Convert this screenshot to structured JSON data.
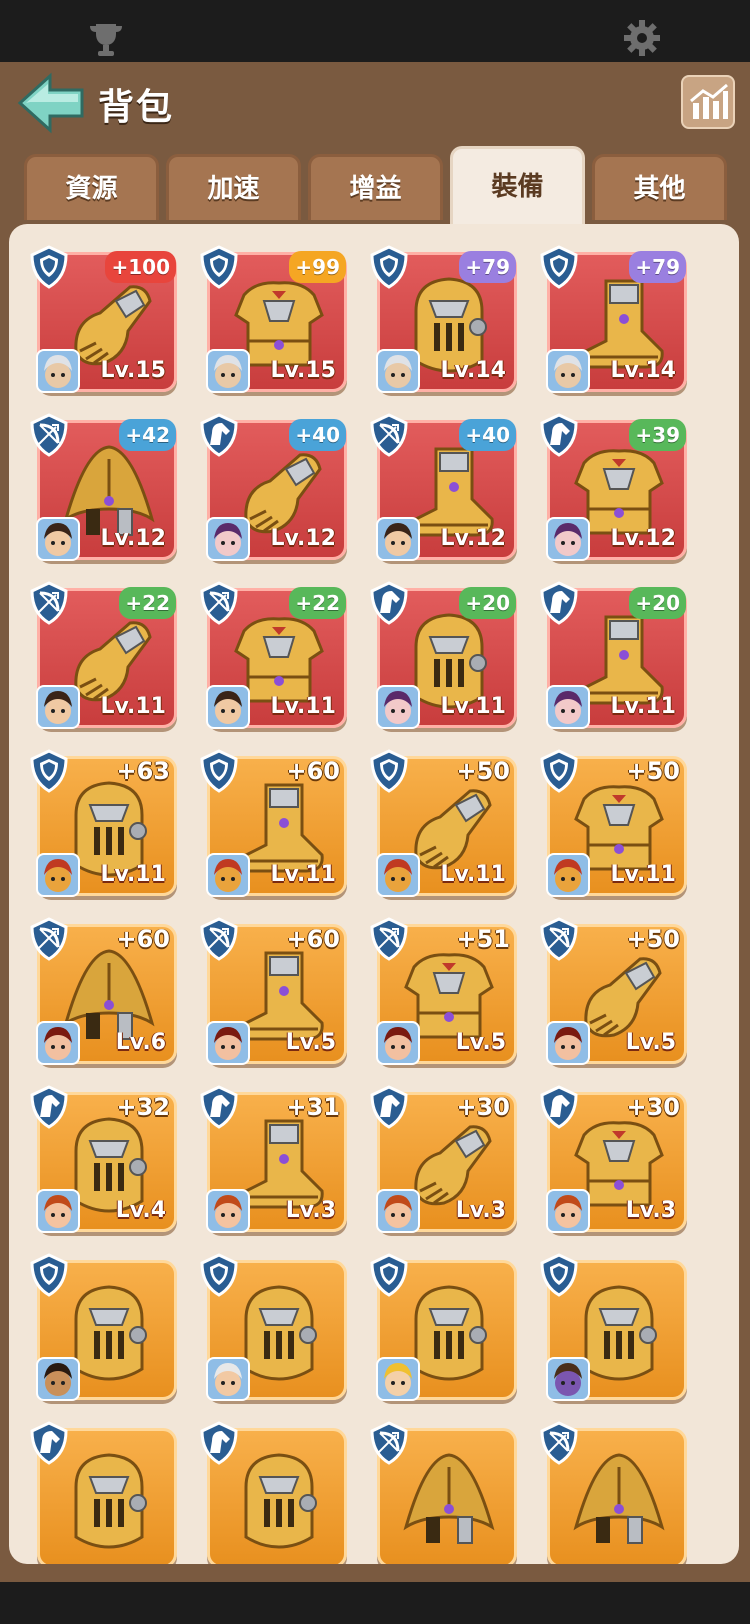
{
  "app": {
    "title": "背包"
  },
  "tabs": [
    {
      "label": "資源",
      "active": false
    },
    {
      "label": "加速",
      "active": false
    },
    {
      "label": "增益",
      "active": false
    },
    {
      "label": "裝備",
      "active": true
    },
    {
      "label": "其他",
      "active": false
    }
  ],
  "colors": {
    "red_card": "#d84b4b",
    "gold_card": "#f0a23a",
    "panel": "#7a5a40",
    "grid_bg": "#f2e6d8"
  },
  "items": [
    {
      "troop": "shield-icon",
      "bonus": "+100",
      "badge_color": "#e8453c",
      "hero": "white-hair",
      "level": "Lv.15",
      "tier": "red",
      "gear": "gauntlet"
    },
    {
      "troop": "shield-icon",
      "bonus": "+99",
      "badge_color": "#f5a623",
      "hero": "white-hair",
      "level": "Lv.15",
      "tier": "red",
      "gear": "chest"
    },
    {
      "troop": "shield-icon",
      "bonus": "+79",
      "badge_color": "#9a7fe0",
      "hero": "white-hair",
      "level": "Lv.14",
      "tier": "red",
      "gear": "helmet"
    },
    {
      "troop": "shield-icon",
      "bonus": "+79",
      "badge_color": "#9a7fe0",
      "hero": "white-hair",
      "level": "Lv.14",
      "tier": "red",
      "gear": "boot"
    },
    {
      "troop": "bow-icon",
      "bonus": "+42",
      "badge_color": "#4aa3d8",
      "hero": "dark-hair",
      "level": "Lv.12",
      "tier": "red",
      "gear": "hood"
    },
    {
      "troop": "horse-icon",
      "bonus": "+40",
      "badge_color": "#4aa3d8",
      "hero": "purple-hair",
      "level": "Lv.12",
      "tier": "red",
      "gear": "gauntlet"
    },
    {
      "troop": "bow-icon",
      "bonus": "+40",
      "badge_color": "#4aa3d8",
      "hero": "dark-hair",
      "level": "Lv.12",
      "tier": "red",
      "gear": "boot"
    },
    {
      "troop": "horse-icon",
      "bonus": "+39",
      "badge_color": "#58b85a",
      "hero": "purple-hair",
      "level": "Lv.12",
      "tier": "red",
      "gear": "chest"
    },
    {
      "troop": "bow-icon",
      "bonus": "+22",
      "badge_color": "#58b85a",
      "hero": "dark-hair",
      "level": "Lv.11",
      "tier": "red",
      "gear": "gauntlet"
    },
    {
      "troop": "bow-icon",
      "bonus": "+22",
      "badge_color": "#58b85a",
      "hero": "dark-hair",
      "level": "Lv.11",
      "tier": "red",
      "gear": "chest"
    },
    {
      "troop": "horse-icon",
      "bonus": "+20",
      "badge_color": "#58b85a",
      "hero": "purple-hair",
      "level": "Lv.11",
      "tier": "red",
      "gear": "helmet"
    },
    {
      "troop": "horse-icon",
      "bonus": "+20",
      "badge_color": "#58b85a",
      "hero": "purple-hair",
      "level": "Lv.11",
      "tier": "red",
      "gear": "boot"
    },
    {
      "troop": "shield-icon",
      "bonus": "+63",
      "badge_color": "",
      "hero": "spartan",
      "level": "Lv.11",
      "tier": "gold",
      "gear": "helmet"
    },
    {
      "troop": "shield-icon",
      "bonus": "+60",
      "badge_color": "",
      "hero": "spartan",
      "level": "Lv.11",
      "tier": "gold",
      "gear": "boot"
    },
    {
      "troop": "shield-icon",
      "bonus": "+50",
      "badge_color": "",
      "hero": "spartan",
      "level": "Lv.11",
      "tier": "gold",
      "gear": "gauntlet"
    },
    {
      "troop": "shield-icon",
      "bonus": "+50",
      "badge_color": "",
      "hero": "spartan",
      "level": "Lv.11",
      "tier": "gold",
      "gear": "chest"
    },
    {
      "troop": "bow-icon",
      "bonus": "+60",
      "badge_color": "",
      "hero": "bandana",
      "level": "Lv.6",
      "tier": "gold",
      "gear": "hood"
    },
    {
      "troop": "bow-icon",
      "bonus": "+60",
      "badge_color": "",
      "hero": "bandana",
      "level": "Lv.5",
      "tier": "gold",
      "gear": "boot"
    },
    {
      "troop": "bow-icon",
      "bonus": "+51",
      "badge_color": "",
      "hero": "bandana",
      "level": "Lv.5",
      "tier": "gold",
      "gear": "chest"
    },
    {
      "troop": "bow-icon",
      "bonus": "+50",
      "badge_color": "",
      "hero": "bandana",
      "level": "Lv.5",
      "tier": "gold",
      "gear": "gauntlet"
    },
    {
      "troop": "horse-icon",
      "bonus": "+32",
      "badge_color": "",
      "hero": "red-hair",
      "level": "Lv.4",
      "tier": "gold",
      "gear": "helmet"
    },
    {
      "troop": "horse-icon",
      "bonus": "+31",
      "badge_color": "",
      "hero": "red-hair",
      "level": "Lv.3",
      "tier": "gold",
      "gear": "boot"
    },
    {
      "troop": "horse-icon",
      "bonus": "+30",
      "badge_color": "",
      "hero": "red-hair",
      "level": "Lv.3",
      "tier": "gold",
      "gear": "gauntlet"
    },
    {
      "troop": "horse-icon",
      "bonus": "+30",
      "badge_color": "",
      "hero": "red-hair",
      "level": "Lv.3",
      "tier": "gold",
      "gear": "chest"
    },
    {
      "troop": "shield-icon",
      "bonus": "",
      "badge_color": "",
      "hero": "warrior",
      "level": "",
      "tier": "gold",
      "gear": "helmet"
    },
    {
      "troop": "shield-icon",
      "bonus": "",
      "badge_color": "",
      "hero": "old-man",
      "level": "",
      "tier": "gold",
      "gear": "helmet"
    },
    {
      "troop": "shield-icon",
      "bonus": "",
      "badge_color": "",
      "hero": "blonde",
      "level": "",
      "tier": "gold",
      "gear": "helmet"
    },
    {
      "troop": "shield-icon",
      "bonus": "",
      "badge_color": "",
      "hero": "bearded",
      "level": "",
      "tier": "gold",
      "gear": "helmet"
    },
    {
      "troop": "horse-icon",
      "bonus": "",
      "badge_color": "",
      "hero": "",
      "level": "",
      "tier": "gold",
      "gear": "helmet"
    },
    {
      "troop": "horse-icon",
      "bonus": "",
      "badge_color": "",
      "hero": "",
      "level": "",
      "tier": "gold",
      "gear": "helmet"
    },
    {
      "troop": "bow-icon",
      "bonus": "",
      "badge_color": "",
      "hero": "",
      "level": "",
      "tier": "gold",
      "gear": "hood"
    },
    {
      "troop": "bow-icon",
      "bonus": "",
      "badge_color": "",
      "hero": "",
      "level": "",
      "tier": "gold",
      "gear": "hood"
    }
  ]
}
